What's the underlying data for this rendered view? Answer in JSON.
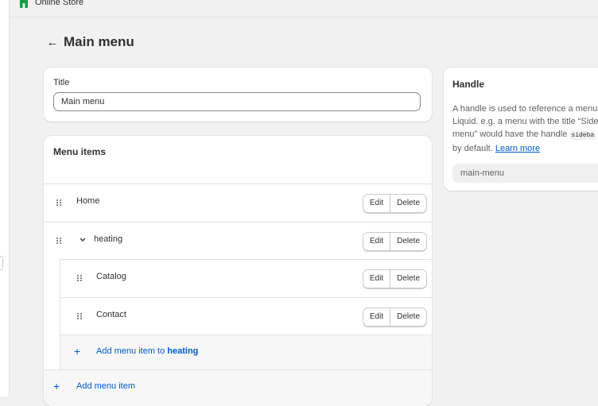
{
  "topbar": {
    "store_label": "Online Store"
  },
  "header": {
    "back_icon": "arrow-left-icon",
    "title": "Main menu"
  },
  "title_card": {
    "label": "Title",
    "value": "Main menu"
  },
  "menu_card": {
    "heading": "Menu items",
    "items": [
      {
        "label": "Home",
        "edit": "Edit",
        "delete": "Delete"
      },
      {
        "label": "heating",
        "edit": "Edit",
        "delete": "Delete",
        "expanded": true,
        "children": [
          {
            "label": "Catalog",
            "edit": "Edit",
            "delete": "Delete"
          },
          {
            "label": "Contact",
            "edit": "Edit",
            "delete": "Delete"
          }
        ]
      }
    ],
    "add_sub_prefix": "Add menu item to",
    "add_sub_target": "heating",
    "add_root": "Add menu item"
  },
  "handle_card": {
    "heading": "Handle",
    "desc_line1": "A handle is used to reference a menu",
    "desc_line2": "Liquid. e.g. a menu with the title “Side",
    "desc_line3_pre": "menu” would have the handle",
    "desc_code": "sideba",
    "desc_line4_pre": "by default.",
    "learn_more": "Learn more",
    "value": "main-menu"
  },
  "colors": {
    "accent": "#005bd3",
    "background": "#f1f1f1",
    "store_icon": "#00a047"
  }
}
